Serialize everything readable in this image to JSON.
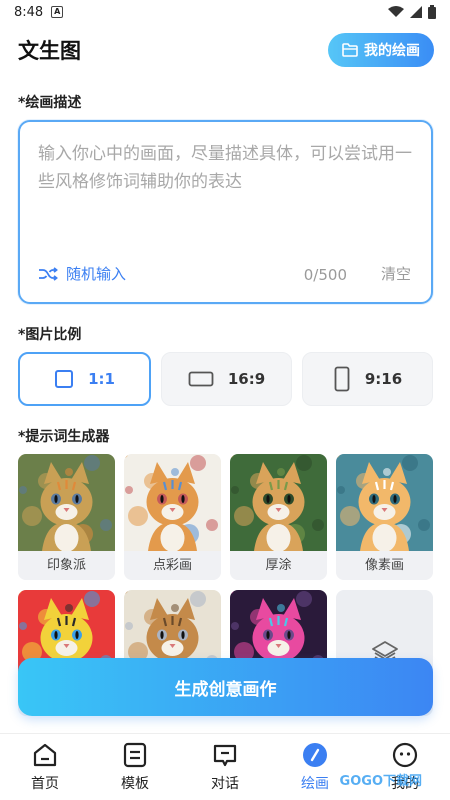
{
  "status_bar": {
    "time": "8:48",
    "app_icon": "A"
  },
  "header": {
    "title": "文生图",
    "my_drawings_label": "我的绘画",
    "folder_icon": "folder-icon"
  },
  "prompt_section": {
    "label": "*绘画描述",
    "placeholder": "输入你心中的画面，尽量描述具体，可以尝试用一些风格修饰词辅助你的表达",
    "random_label": "随机输入",
    "char_count": "0/500",
    "clear_label": "清空"
  },
  "ratio_section": {
    "label": "*图片比例",
    "options": [
      {
        "label": "1:1",
        "icon": "square-icon",
        "selected": true
      },
      {
        "label": "16:9",
        "icon": "landscape-icon",
        "selected": false
      },
      {
        "label": "9:16",
        "icon": "portrait-icon",
        "selected": false
      }
    ]
  },
  "style_section": {
    "label": "*提示词生成器",
    "styles": [
      {
        "label": "印象派",
        "palette": [
          "#6b7f4a",
          "#c9a055",
          "#e08a3a",
          "#5a7aa0"
        ]
      },
      {
        "label": "点彩画",
        "palette": [
          "#f2efe8",
          "#e39a4c",
          "#5a8fd0",
          "#c45a5a"
        ]
      },
      {
        "label": "厚涂",
        "palette": [
          "#3f6b3a",
          "#d9a35a",
          "#7a9a4a",
          "#2d4a2a"
        ]
      },
      {
        "label": "像素画",
        "palette": [
          "#4a8b9b",
          "#f2b86a",
          "#ffffff",
          "#2f6a7a"
        ]
      },
      {
        "label": "",
        "palette": [
          "#e83a3a",
          "#f2d23a",
          "#2a2a2a",
          "#3aa0e8"
        ]
      },
      {
        "label": "",
        "palette": [
          "#e8e2d4",
          "#c48a4a",
          "#6a4a2a",
          "#aab4c4"
        ]
      },
      {
        "label": "",
        "palette": [
          "#2a1a3a",
          "#e84aa0",
          "#4ac8e8",
          "#6a4a8a"
        ]
      }
    ],
    "more_icon": "layers-icon"
  },
  "generate_label": "生成创意画作",
  "bottom_nav": [
    {
      "label": "首页",
      "icon": "home-icon",
      "active": false
    },
    {
      "label": "模板",
      "icon": "template-icon",
      "active": false
    },
    {
      "label": "对话",
      "icon": "chat-icon",
      "active": false
    },
    {
      "label": "绘画",
      "icon": "brush-icon",
      "active": true
    },
    {
      "label": "我的",
      "icon": "profile-icon",
      "active": false
    }
  ],
  "watermark": "GOGO下载网",
  "colors": {
    "accent": "#3b7ff2",
    "gradient_start": "#39c6f6",
    "gradient_end": "#3c86f3"
  }
}
